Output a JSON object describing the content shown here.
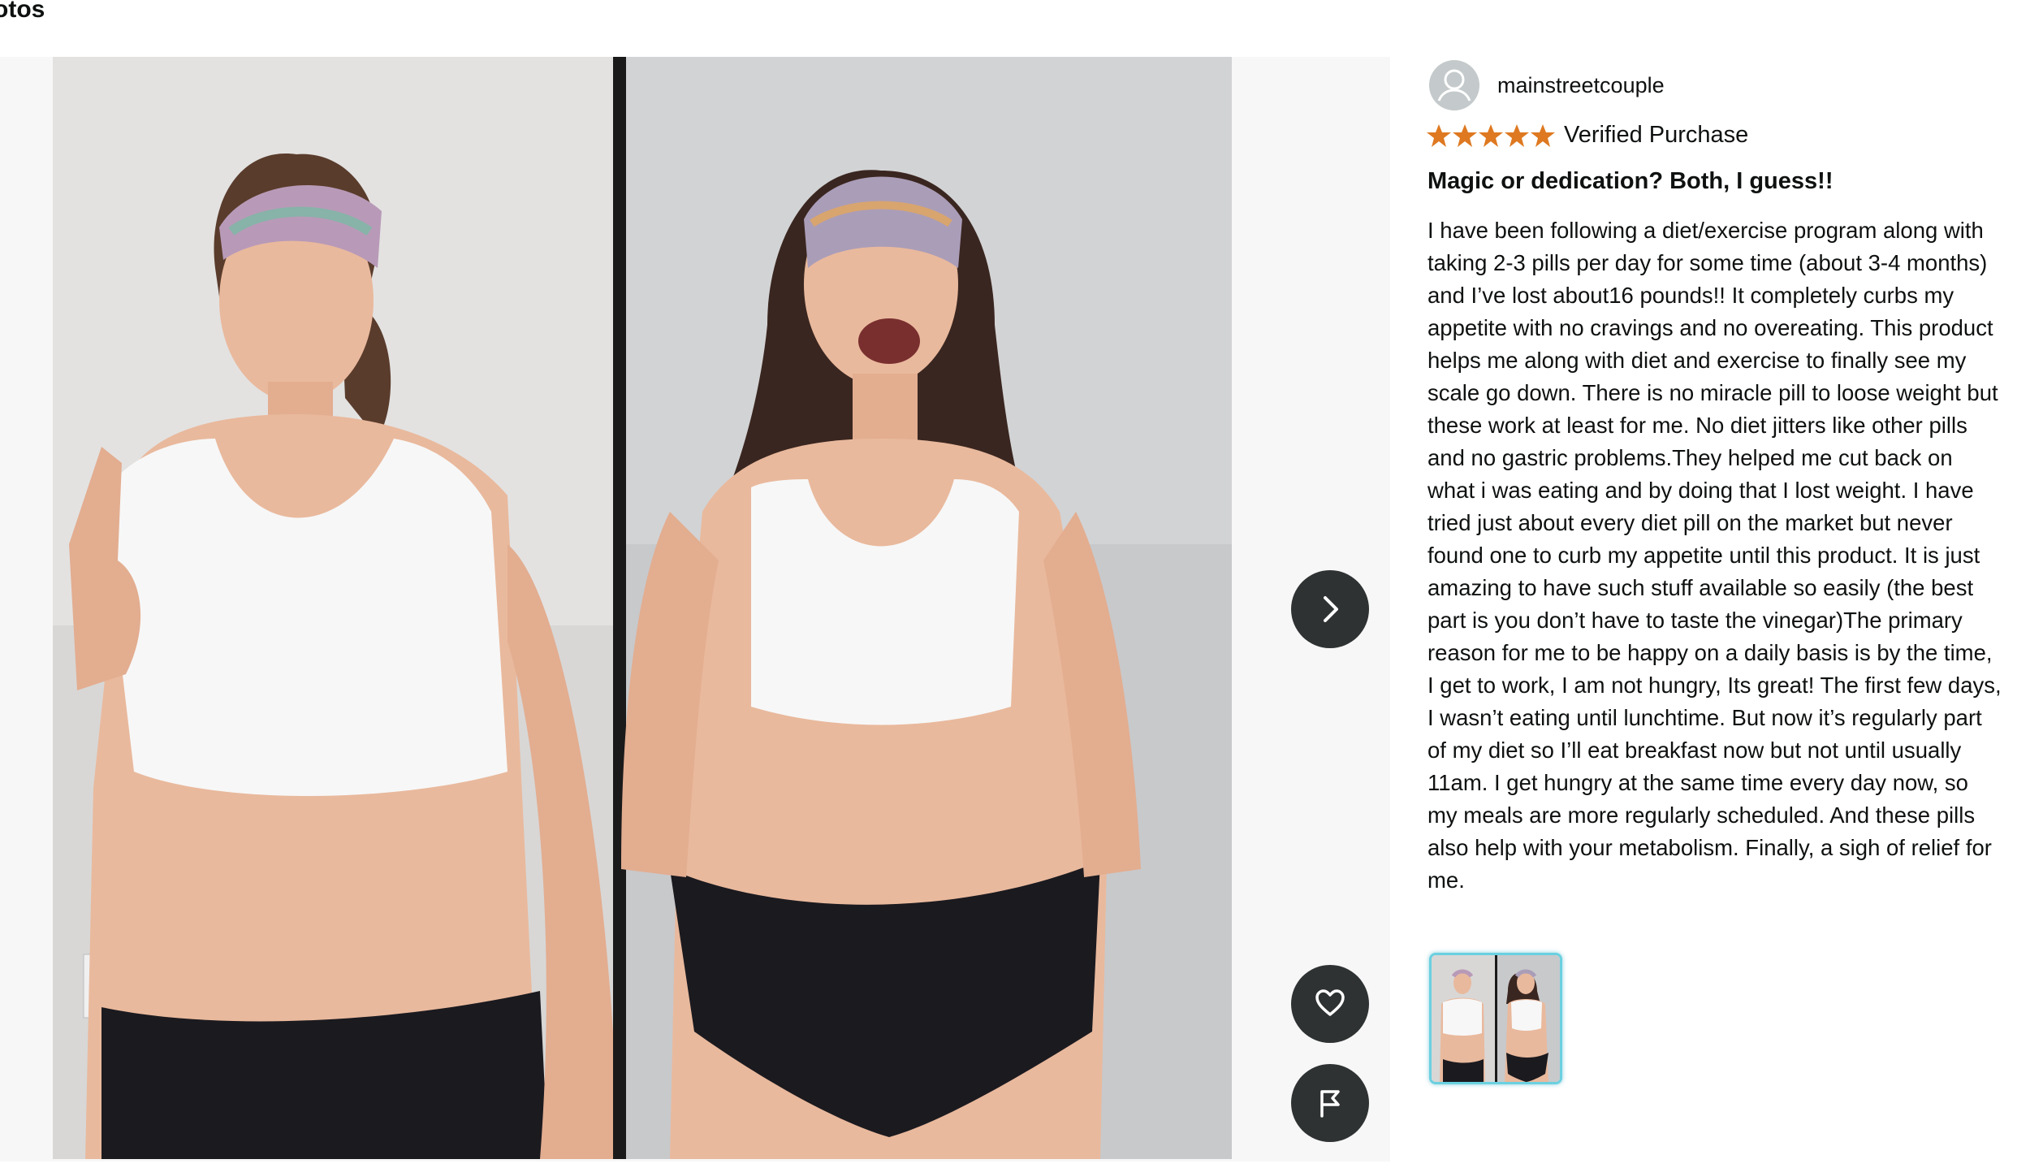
{
  "section": {
    "title": "otos"
  },
  "reviewer": {
    "name": "mainstreetcouple"
  },
  "review": {
    "rating": 5,
    "rating_max": 5,
    "verified_label": "Verified Purchase",
    "title": "Magic or dedication? Both, I guess!!",
    "body": "I have been following a diet/exercise program along with taking 2-3 pills per day for some time (about 3-4 months) and I’ve lost about16 pounds!! It completely curbs my appetite with no cravings and no overeating. This product helps me along with diet and exercise to finally see my scale go down. There is no miracle pill to loose weight but these work at least for me. No diet jitters like other pills and no gastric problems.They helped me cut back on what i was eating and by doing that I lost weight. I have tried just about every diet pill on the market but never found one to curb my appetite until this product. It is just amazing to have such stuff available so easily (the best part is you don’t have to taste the vinegar)The primary reason for me to be happy on a daily basis is by the time, I get to work, I am not hungry, Its great! The first few days, I wasn’t eating until lunchtime. But now it’s regularly part of my diet so I’ll eat breakfast now but not until usually 11am. I get hungry at the same time every day now, so my meals are more regularly scheduled. And these pills also help with your metabolism. Finally, a sigh of relief for me."
  },
  "controls": {
    "next_icon": "chevron-right-icon",
    "like_icon": "heart-icon",
    "report_icon": "flag-icon"
  },
  "colors": {
    "star": "#de7921",
    "button_bg": "#2f3233",
    "thumb_border": "#6ad0e0",
    "viewer_bg": "#f7f7f7"
  }
}
